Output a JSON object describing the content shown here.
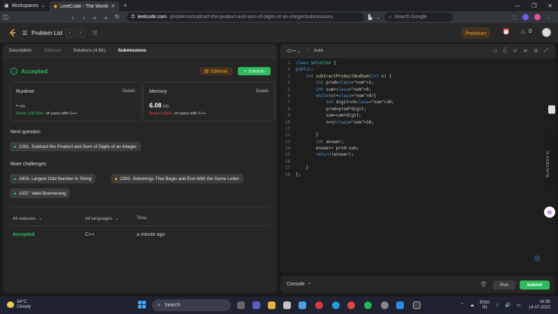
{
  "browser": {
    "workspaces_label": "Workspaces",
    "tab_title": "LeetCode - The World's Lea",
    "url_host": "leetcode.com",
    "url_path": "/problems/subtract-the-product-and-sum-of-digits-of-an-integer/submissions",
    "search_placeholder": "Search Google"
  },
  "header": {
    "problem_list": "Problem List",
    "premium": "Premium",
    "streak": "0"
  },
  "left_tabs": [
    "Description",
    "Editorial",
    "Solutions (4.6K)",
    "Submissions"
  ],
  "result": {
    "status": "Accepted",
    "editorial_btn": "Editorial",
    "solution_btn": "Solution"
  },
  "runtime": {
    "title": "Runtime",
    "details": "Details",
    "value": "-",
    "unit": "ms",
    "beats_pct": "Beats 100.00%",
    "beats_suffix": "of users with C++"
  },
  "memory": {
    "title": "Memory",
    "details": "Details",
    "value": "6.08",
    "unit": "mb",
    "beats_pct": "Beats 9.99%",
    "beats_suffix": "of users with C++"
  },
  "next_question": {
    "heading": "Next question",
    "item": "1281. Subtract the Product and Sum of Digits of an Integer"
  },
  "more": {
    "heading": "More challenges",
    "items": [
      "1903. Largest Odd Number in String",
      "2083. Substrings That Begin and End With the Same Letter",
      "1037. Valid Boomerang"
    ]
  },
  "table": {
    "col_status": "All statuses",
    "col_lang": "All languages",
    "col_time": "Time",
    "row_status": "Accepted",
    "row_lang": "C++",
    "row_time": "a minute ago"
  },
  "editor": {
    "language": "C++",
    "mode": "Auto",
    "lines": [
      "class Solution {",
      "public:",
      "    int subtractProductAndSum(int n) {",
      "        int prod=1;",
      "        int sum=0;",
      "        while(n!=0){",
      "            int digit=n%10;",
      "            prod=prod*digit;",
      "            sum=sum+digit;",
      "            n=n/10;",
      "",
      "        }",
      "        int answer;",
      "        answer= prod-sum;",
      "        return(answer);",
      "",
      "    }",
      "};"
    ]
  },
  "console": {
    "label": "Console",
    "run": "Run",
    "submit": "Submit"
  },
  "sidebar_ext": "BLACKBOX AI",
  "taskbar": {
    "temp": "34°C",
    "weather": "Cloudy",
    "search": "Search",
    "lang1": "ENG",
    "lang2": "IN",
    "time": "16:36",
    "date": "14-07-2023"
  },
  "colors": {
    "accepted_green": "#2cbb5d",
    "premium_orange": "#ffa116",
    "beats_red": "#ef4743"
  }
}
